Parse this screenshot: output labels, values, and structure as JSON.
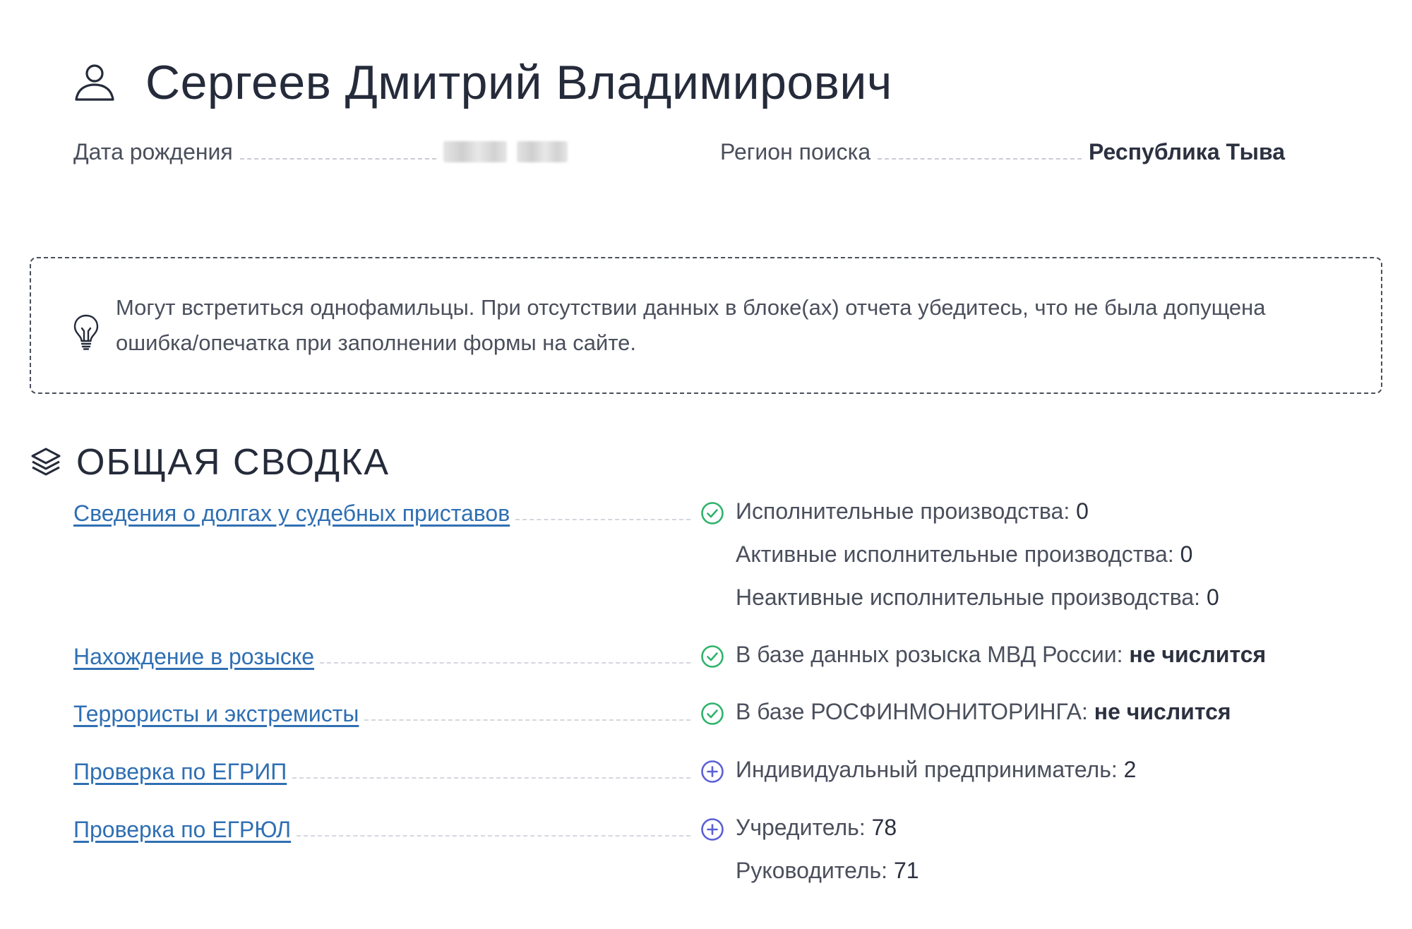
{
  "person": {
    "name": "Сергеев Дмитрий Владимирович"
  },
  "info": {
    "birth_label": "Дата рождения",
    "region_label": "Регион поиска",
    "region_value": "Республика Тыва"
  },
  "notice": {
    "line1": "Могут встретиться однофамильцы. При отсутствии данных в блоке(ах) отчета убедитесь, что не была допущена",
    "line2": "ошибка/опечатка при заполнении формы на сайте."
  },
  "summary": {
    "title": "ОБЩАЯ СВОДКА",
    "rows": [
      {
        "link": "Сведения о долгах у судебных приставов",
        "status": "check",
        "lines": [
          {
            "label": "Исполнительные производства: ",
            "value": "0"
          },
          {
            "label": "Активные исполнительные производства: ",
            "value": "0"
          },
          {
            "label": "Неактивные исполнительные производства: ",
            "value": "0"
          }
        ]
      },
      {
        "link": "Нахождение в розыске",
        "status": "check",
        "lines": [
          {
            "label": "В базе данных розыска МВД России: ",
            "value": "не числится"
          }
        ]
      },
      {
        "link": "Террористы и экстремисты",
        "status": "check",
        "lines": [
          {
            "label": "В базе РОСФИНМОНИТОРИНГА: ",
            "value": "не числится"
          }
        ]
      },
      {
        "link": "Проверка по ЕГРИП",
        "status": "plus",
        "lines": [
          {
            "label": "Индивидуальный предприниматель: ",
            "value": "2"
          }
        ]
      },
      {
        "link": "Проверка по ЕГРЮЛ",
        "status": "plus",
        "lines": [
          {
            "label": "Учредитель: ",
            "value": "78"
          },
          {
            "label": "Руководитель: ",
            "value": "71"
          }
        ]
      }
    ]
  },
  "colors": {
    "link": "#2f6fb3",
    "check": "#2fb36b",
    "plus": "#5b5fd6",
    "text": "#252b3a"
  },
  "icons": {
    "header": "user-icon",
    "notice": "lightbulb-icon",
    "section": "layers-icon",
    "check": "check-circle-icon",
    "plus": "plus-circle-icon"
  }
}
